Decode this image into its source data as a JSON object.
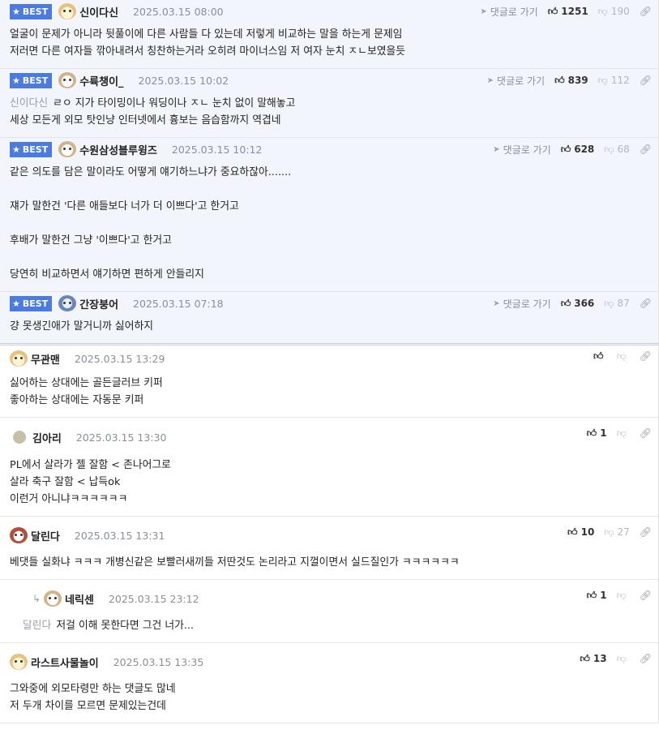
{
  "comments": [
    {
      "best": true,
      "badge": "BEST",
      "nick": "신이다신",
      "date": "2025.03.15 08:00",
      "reply_label": "댓글로 가기",
      "up": "1251",
      "down": "190",
      "lines": [
        "얼굴이 문제가 아니라 뒷풀이에 다른 사람들 다 있는데 저렇게 비교하는 말을 하는게 문제임",
        "저러면 다른 여자들 깎아내려서 칭찬하는거라 오히려 마이너스임 저 여자 눈치 ㅈㄴ보였을듯"
      ]
    },
    {
      "best": true,
      "badge": "BEST",
      "nick": "수륙챙이_",
      "date": "2025.03.15 10:02",
      "reply_label": "댓글로 가기",
      "up": "839",
      "down": "112",
      "mention": "신이다신",
      "lines": [
        "ㄹㅇ 지가 타이밍이나 워딩이나 ㅈㄴ 눈치 없이 말해놓고",
        "세상 모든게 외모 탓인냥 인터넷에서 흉보는 음습함까지 역겹네"
      ]
    },
    {
      "best": true,
      "badge": "BEST",
      "nick": "수원삼성블루윙즈",
      "date": "2025.03.15 10:12",
      "reply_label": "댓글로 가기",
      "up": "628",
      "down": "68",
      "lines": [
        "같은 의도를 담은 말이라도 어떻게 얘기하느냐가 중요하잖아.......",
        "",
        "쟤가 말한건 '다른 애들보다 너가 더 이쁘다'고 한거고",
        "",
        "후배가 말한건 그냥 '이쁘다'고 한거고",
        "",
        "당연히 비교하면서 얘기하면 편하게 안들리지"
      ]
    },
    {
      "best": true,
      "badge": "BEST",
      "nick": "간장붕어",
      "date": "2025.03.15 07:18",
      "reply_label": "댓글로 가기",
      "up": "366",
      "down": "87",
      "lines": [
        "걍 못생긴애가 말거니까 싫어하지"
      ]
    },
    {
      "best": false,
      "nick": "무관맨",
      "date": "2025.03.15 13:29",
      "up": "",
      "down": "",
      "lines": [
        "싫어하는 상대에는 골든글러브 키퍼",
        "좋아하는 상대에는 자동문 키퍼"
      ]
    },
    {
      "best": false,
      "nick": "김아리",
      "date": "2025.03.15 13:30",
      "up": "1",
      "down": "",
      "lines": [
        "PL에서 살라가 젤 잘함 < 존나어그로",
        "살라 축구 잘함 < 납득ok",
        "이런거 아니냐ㅋㅋㅋㅋㅋㅋ"
      ]
    },
    {
      "best": false,
      "nick": "달린다",
      "date": "2025.03.15 13:31",
      "up": "10",
      "down": "27",
      "lines": [
        "베댓들 실화냐 ㅋㅋㅋ 개병신같은 보빨러새끼들 저딴것도 논리라고 지껄이면서 실드질인가 ㅋㅋㅋㅋㅋㅋ"
      ]
    },
    {
      "best": false,
      "reply": true,
      "nick": "네릭센",
      "date": "2025.03.15 23:12",
      "up": "1",
      "down": "",
      "mention": "달린다",
      "lines": [
        "저걸 이해 못한다면 그건 너가..."
      ]
    },
    {
      "best": false,
      "nick": "라스트사물놀이",
      "date": "2025.03.15 13:35",
      "up": "13",
      "down": "",
      "lines": [
        "그와중에 외모타령만 하는 댓글도 많네",
        "저 두개 차이를 모르면 문제있는건데"
      ]
    }
  ]
}
